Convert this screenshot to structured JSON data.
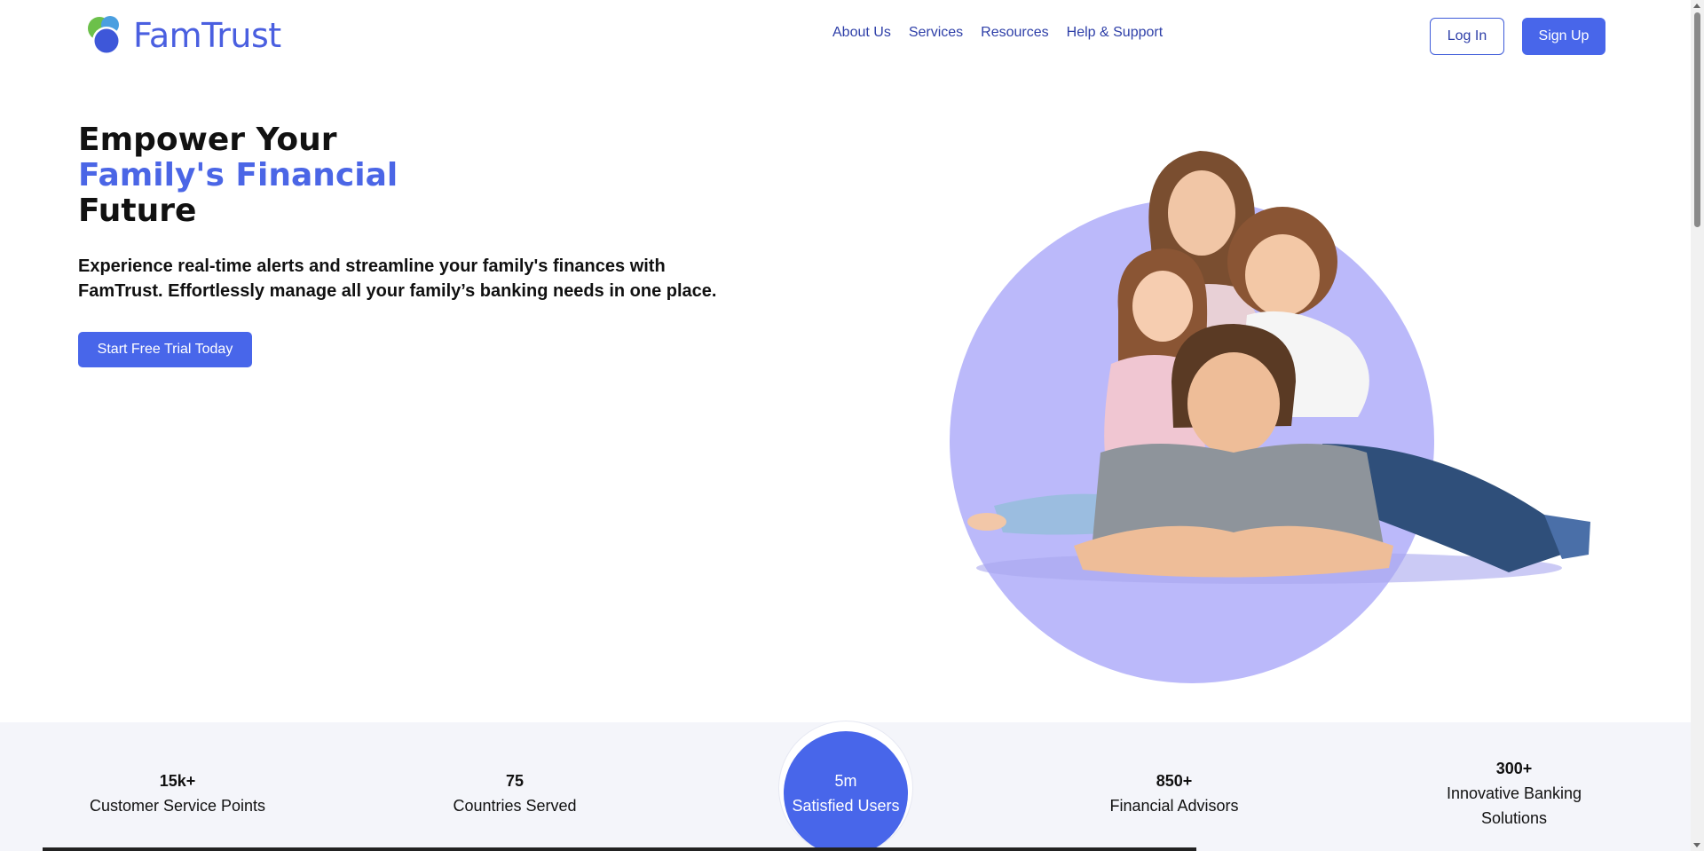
{
  "brand": {
    "name": "FamTrust",
    "primary_color": "#4866ea",
    "accent_color": "#bbb9fa",
    "logo_icon": "famtrust-logo-icon"
  },
  "nav": {
    "items": [
      {
        "label": "About Us"
      },
      {
        "label": "Services"
      },
      {
        "label": "Resources"
      },
      {
        "label": "Help & Support"
      }
    ],
    "login_label": "Log In",
    "signup_label": "Sign Up"
  },
  "hero": {
    "title_line1": "Empower Your",
    "title_accent": "Family's Financial",
    "title_line3": "Future",
    "subtitle": "Experience real-time alerts and streamline your family's finances with FamTrust. Effortlessly manage all your family’s banking needs in one place.",
    "cta_label": "Start Free Trial Today",
    "image": "family-photo-illustration"
  },
  "stats": [
    {
      "value": "15k+",
      "label": "Customer Service Points"
    },
    {
      "value": "75",
      "label": "Countries Served"
    },
    {
      "value": "5m",
      "label": "Satisfied Users",
      "highlighted": true
    },
    {
      "value": "850+",
      "label": "Financial Advisors"
    },
    {
      "value": "300+",
      "label": "Innovative Banking Solutions"
    }
  ]
}
